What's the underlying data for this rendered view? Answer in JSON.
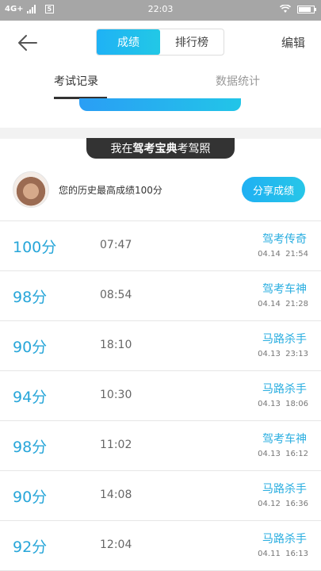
{
  "status_bar": {
    "network": "4G+",
    "sim_badge": "5",
    "time": "22:03",
    "battery_level": 0.85
  },
  "header": {
    "tabs": [
      {
        "label": "成绩",
        "active": true
      },
      {
        "label": "排行榜",
        "active": false
      }
    ],
    "edit_label": "编辑"
  },
  "sub_tabs": [
    {
      "label": "考试记录",
      "active": true
    },
    {
      "label": "数据统计",
      "active": false
    }
  ],
  "brand": {
    "prefix": "我在",
    "name": "驾考宝典",
    "suffix": "考驾照"
  },
  "profile": {
    "text": "您的历史最高成绩100分",
    "share_label": "分享成绩"
  },
  "records": [
    {
      "score": "100分",
      "duration": "07:47",
      "title": "驾考传奇",
      "date": "04.14",
      "time": "21:54"
    },
    {
      "score": "98分",
      "duration": "08:54",
      "title": "驾考车神",
      "date": "04.14",
      "time": "21:28"
    },
    {
      "score": "90分",
      "duration": "18:10",
      "title": "马路杀手",
      "date": "04.13",
      "time": "23:13"
    },
    {
      "score": "94分",
      "duration": "10:30",
      "title": "马路杀手",
      "date": "04.13",
      "time": "18:06"
    },
    {
      "score": "98分",
      "duration": "11:02",
      "title": "驾考车神",
      "date": "04.13",
      "time": "16:12"
    },
    {
      "score": "90分",
      "duration": "14:08",
      "title": "马路杀手",
      "date": "04.12",
      "time": "16:36"
    },
    {
      "score": "92分",
      "duration": "12:04",
      "title": "马路杀手",
      "date": "04.11",
      "time": "16:13"
    }
  ],
  "colors": {
    "accent": "#27a6d9",
    "status_bar": "#a6a6a6",
    "brand_pill": "#333333"
  },
  "icons": {
    "back": "arrow-left-icon",
    "wifi": "wifi-icon",
    "signal": "signal-icon",
    "battery": "battery-icon"
  }
}
